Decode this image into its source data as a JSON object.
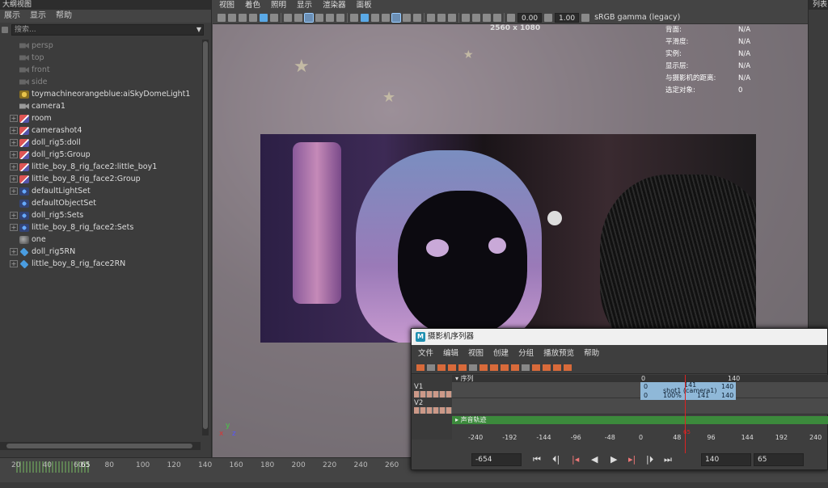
{
  "outliner": {
    "title": "大纲视图",
    "menu": [
      "展示",
      "显示",
      "帮助"
    ],
    "search_placeholder": "搜索...",
    "items": [
      {
        "label": "persp",
        "icon": "camera-icon",
        "dim": true,
        "expandable": false
      },
      {
        "label": "top",
        "icon": "camera-icon",
        "dim": true,
        "expandable": false
      },
      {
        "label": "front",
        "icon": "camera-icon",
        "dim": true,
        "expandable": false
      },
      {
        "label": "side",
        "icon": "camera-icon",
        "dim": true,
        "expandable": false
      },
      {
        "label": "toymachineorangeblue:aiSkyDomeLight1",
        "icon": "light-icon",
        "dim": false,
        "expandable": false
      },
      {
        "label": "camera1",
        "icon": "camera-icon",
        "dim": false,
        "expandable": false
      },
      {
        "label": "room",
        "icon": "transform-icon",
        "dim": false,
        "expandable": true
      },
      {
        "label": "camerashot4",
        "icon": "transform-icon",
        "dim": false,
        "expandable": true
      },
      {
        "label": "doll_rig5:doll",
        "icon": "transform-icon",
        "dim": false,
        "expandable": true
      },
      {
        "label": "doll_rig5:Group",
        "icon": "transform-icon",
        "dim": false,
        "expandable": true
      },
      {
        "label": "little_boy_8_rig_face2:little_boy1",
        "icon": "transform-icon",
        "dim": false,
        "expandable": true
      },
      {
        "label": "little_boy_8_rig_face2:Group",
        "icon": "transform-icon",
        "dim": false,
        "expandable": true
      },
      {
        "label": "defaultLightSet",
        "icon": "set-icon",
        "dim": false,
        "expandable": true
      },
      {
        "label": "defaultObjectSet",
        "icon": "set-icon",
        "dim": false,
        "expandable": false
      },
      {
        "label": "doll_rig5:Sets",
        "icon": "set-icon",
        "dim": false,
        "expandable": true
      },
      {
        "label": "little_boy_8_rig_face2:Sets",
        "icon": "set-icon",
        "dim": false,
        "expandable": true
      },
      {
        "label": "one",
        "icon": "sphere-icon",
        "dim": false,
        "expandable": false
      },
      {
        "label": "doll_rig5RN",
        "icon": "reference-icon",
        "dim": false,
        "expandable": true
      },
      {
        "label": "little_boy_8_rig_face2RN",
        "icon": "reference-icon",
        "dim": false,
        "expandable": true
      }
    ]
  },
  "viewport": {
    "menu": [
      "视图",
      "着色",
      "照明",
      "显示",
      "渲染器",
      "面板"
    ],
    "exposure": "0.00",
    "gamma": "1.00",
    "color_space": "sRGB gamma (legacy)",
    "resolution": "2560 x 1080",
    "hud": [
      {
        "label": "背面:",
        "value": "N/A"
      },
      {
        "label": "平滑度:",
        "value": "N/A"
      },
      {
        "label": "实例:",
        "value": "N/A"
      },
      {
        "label": "显示层:",
        "value": "N/A"
      },
      {
        "label": "与摄影机的距离:",
        "value": "N/A"
      },
      {
        "label": "选定对象:",
        "value": "0"
      }
    ]
  },
  "right_panel": {
    "title": "列表"
  },
  "timeslider": {
    "ticks": [
      "20",
      "40",
      "60",
      "80",
      "100",
      "120",
      "140",
      "160",
      "180",
      "200",
      "220",
      "240",
      "260"
    ],
    "current": "65"
  },
  "sequencer": {
    "title": "摄影机序列器",
    "menu": [
      "文件",
      "编辑",
      "视图",
      "创建",
      "分组",
      "播放预览",
      "帮助"
    ],
    "sequence_label": "序列",
    "tracks": [
      "V1",
      "V2"
    ],
    "audio_label": "声音轨迹",
    "shot": {
      "name": "shot1 (camera1)",
      "seq_start": "0",
      "seq_end": "140",
      "start": "0",
      "end": "140",
      "scale": "100%",
      "mid": "141",
      "mid2": "141",
      "header_start": "0",
      "header_end": "140",
      "header_mid": "141"
    },
    "ruler": [
      "-240",
      "-192",
      "-144",
      "-96",
      "-48",
      "0",
      "48",
      "96",
      "144",
      "192",
      "240"
    ],
    "ruler_current": "65",
    "range_start": "-654",
    "range_end": "140",
    "current_frame": "65",
    "colors": {
      "shot": "#8fb8d8",
      "audio": "#3c8a3c",
      "playhead": "#dd2222"
    }
  }
}
